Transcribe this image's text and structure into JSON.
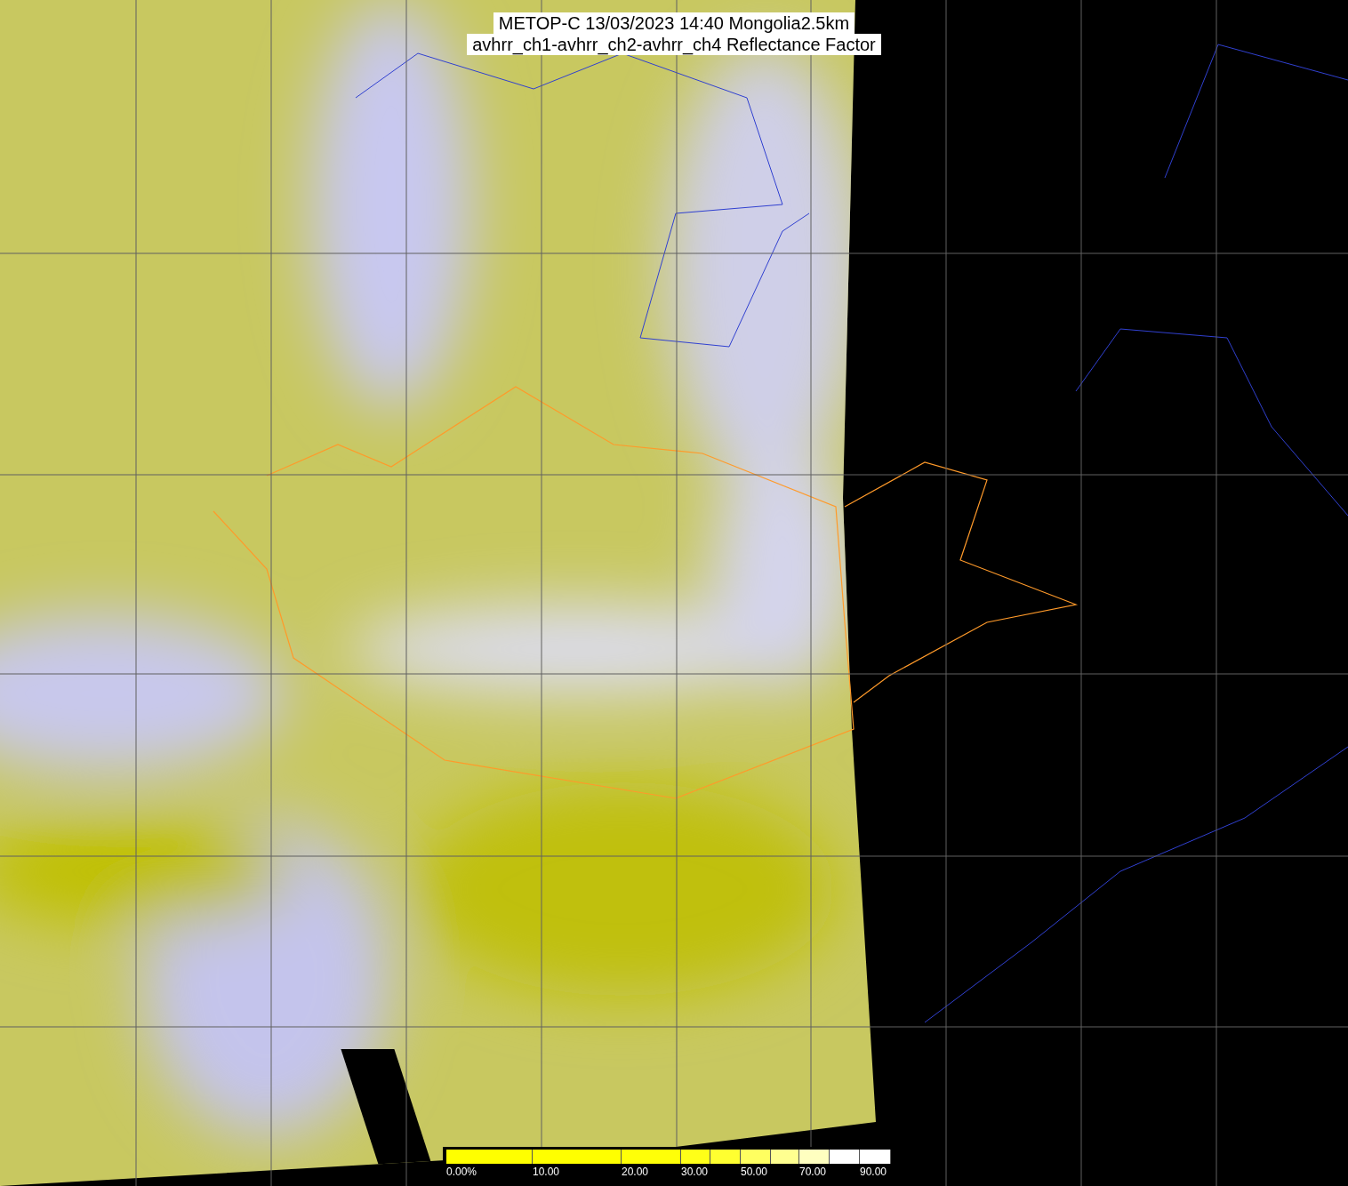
{
  "title_lines": [
    "METOP-C 13/03/2023 14:40 Mongolia2.5km",
    "avhrr_ch1-avhrr_ch2-avhrr_ch4 Reflectance Factor"
  ],
  "colorbar": {
    "segments": [
      {
        "color": "#ffff00"
      },
      {
        "color": "#ffff00"
      },
      {
        "color": "#ffff08"
      },
      {
        "color": "#ffff18"
      },
      {
        "color": "#ffff30"
      },
      {
        "color": "#ffff60"
      },
      {
        "color": "#ffff90"
      },
      {
        "color": "#ffffc0"
      },
      {
        "color": "#ffffff"
      },
      {
        "color": "#ffffff"
      }
    ],
    "labels": [
      "0.00%",
      "10.00",
      "20.00",
      "30.00",
      "50.00",
      "70.00",
      "90.00"
    ]
  }
}
